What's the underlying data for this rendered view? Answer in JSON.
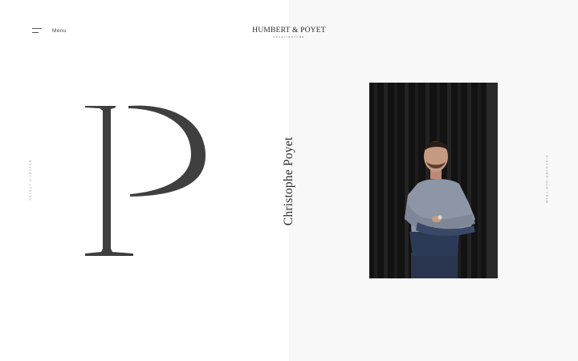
{
  "header": {
    "menu_label": "Menu",
    "logo_main": "HUMBERT & POYET",
    "logo_sub": "ARCHITECTURE"
  },
  "side": {
    "left_label": "SELECT A LETTER",
    "right_label": "DISCOVER OUR TEAM"
  },
  "feature": {
    "letter": "P",
    "name": "Christophe Poyet"
  },
  "icons": {
    "menu": "hamburger-menu-icon"
  },
  "colors": {
    "left_bg": "#ffffff",
    "right_bg": "#f8f8f8",
    "text": "#3a3a3a"
  }
}
